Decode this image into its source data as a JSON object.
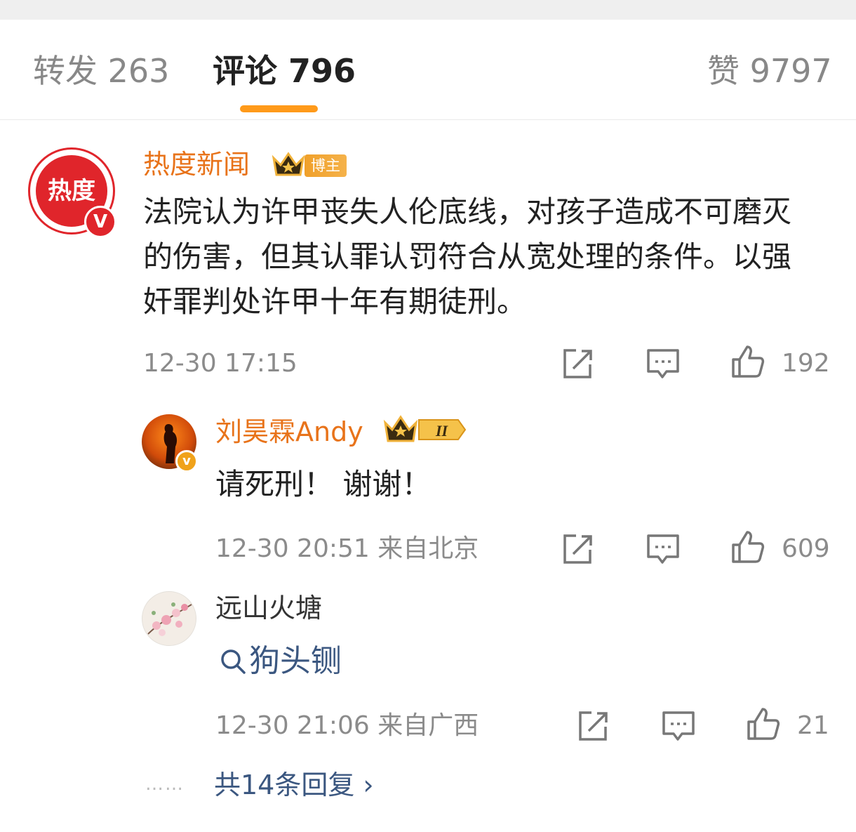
{
  "tabs": {
    "repost": "转发 263",
    "comments": "评论 796",
    "likes": "赞 9797"
  },
  "main_comment": {
    "avatar_text": "热度",
    "username": "热度新闻",
    "tag": "博主",
    "content": "法院认为许甲丧失人伦底线，对孩子造成不可磨灭的伤害，但其认罪认罚符合从宽处理的条件。以强奸罪判处许甲十年有期徒刑。",
    "time": "12-30 17:15",
    "like_count": "192"
  },
  "replies": [
    {
      "username": "刘昊霖Andy",
      "content": "请死刑！ 谢谢！",
      "meta": "12-30 20:51  来自北京",
      "like_count": "609"
    },
    {
      "username": "远山火塘",
      "content": "狗头铡",
      "meta": "12-30 21:06  来自广西",
      "like_count": "21"
    }
  ],
  "more_replies": "共14条回复 ›",
  "dots": "……",
  "colors": {
    "accent": "#ff9a1a",
    "username_orange": "#e8731a",
    "link_blue": "#3b5780",
    "muted": "#8b8b8b",
    "avatar_red": "#e0252b"
  },
  "icons": [
    "crown-badge-icon",
    "repost-icon",
    "comment-icon",
    "like-icon",
    "search-icon",
    "verified-icon"
  ]
}
